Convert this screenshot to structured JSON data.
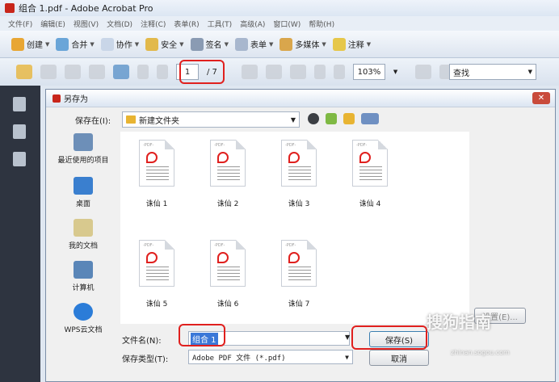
{
  "window": {
    "title": "组合 1.pdf - Adobe Acrobat Pro"
  },
  "menu": [
    "文件(F)",
    "编辑(E)",
    "视图(V)",
    "文档(D)",
    "注释(C)",
    "表单(R)",
    "工具(T)",
    "高级(A)",
    "窗口(W)",
    "帮助(H)"
  ],
  "toolbar": {
    "items": [
      {
        "label": "创建",
        "color": "#e8a634"
      },
      {
        "label": "合并",
        "color": "#6aa5d8"
      },
      {
        "label": "协作",
        "color": "#c9d6e8"
      },
      {
        "label": "安全",
        "color": "#e2b94b"
      },
      {
        "label": "签名",
        "color": "#8a9bb3"
      },
      {
        "label": "表单",
        "color": "#a8b7ce"
      },
      {
        "label": "多媒体",
        "color": "#d9a64c"
      },
      {
        "label": "注释",
        "color": "#e6c74a"
      }
    ]
  },
  "nav": {
    "page_current": "1",
    "page_total": "/ 7",
    "zoom": "103%",
    "search_placeholder": "查找"
  },
  "dialog": {
    "title": "另存为",
    "save_in_label": "保存在(I):",
    "save_in_value": "新建文件夹",
    "places": [
      {
        "label": "最近使用的项目",
        "color": "#6d8fb8"
      },
      {
        "label": "桌面",
        "color": "#3a7fcf"
      },
      {
        "label": "我的文档",
        "color": "#d8c98e"
      },
      {
        "label": "计算机",
        "color": "#5a86b8"
      },
      {
        "label": "WPS云文档",
        "color": "#2b7cd8"
      }
    ],
    "files": [
      "诛仙 1",
      "诛仙 2",
      "诛仙 3",
      "诛仙 4",
      "诛仙 5",
      "诛仙 6",
      "诛仙 7"
    ],
    "file_tag": "-PDF-",
    "filename_label": "文件名(N):",
    "filename_value": "组合 1",
    "filetype_label": "保存类型(T):",
    "filetype_value": "Adobe PDF 文件 (*.pdf)",
    "save_button": "保存(S)",
    "cancel_button": "取消",
    "settings_button": "设置(E)..."
  },
  "watermark": {
    "text": "搜狗指南",
    "url": "zhinan.sogou.com"
  },
  "colors": {
    "highlight": "#e0201e",
    "selection": "#3b78d8"
  }
}
